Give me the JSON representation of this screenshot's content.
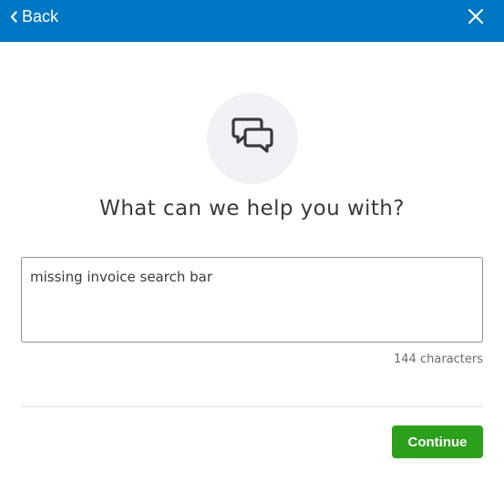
{
  "header": {
    "back_label": "Back",
    "back_icon": "chevron-left-icon",
    "close_icon": "close-icon",
    "background_color": "#0077c5"
  },
  "main": {
    "hero_icon": "chat-bubbles-icon",
    "title": "What can we help you with?",
    "question_input_value": "missing invoice search bar",
    "char_count": "144 characters"
  },
  "footer": {
    "continue_label": "Continue",
    "continue_color": "#2ca01c"
  }
}
